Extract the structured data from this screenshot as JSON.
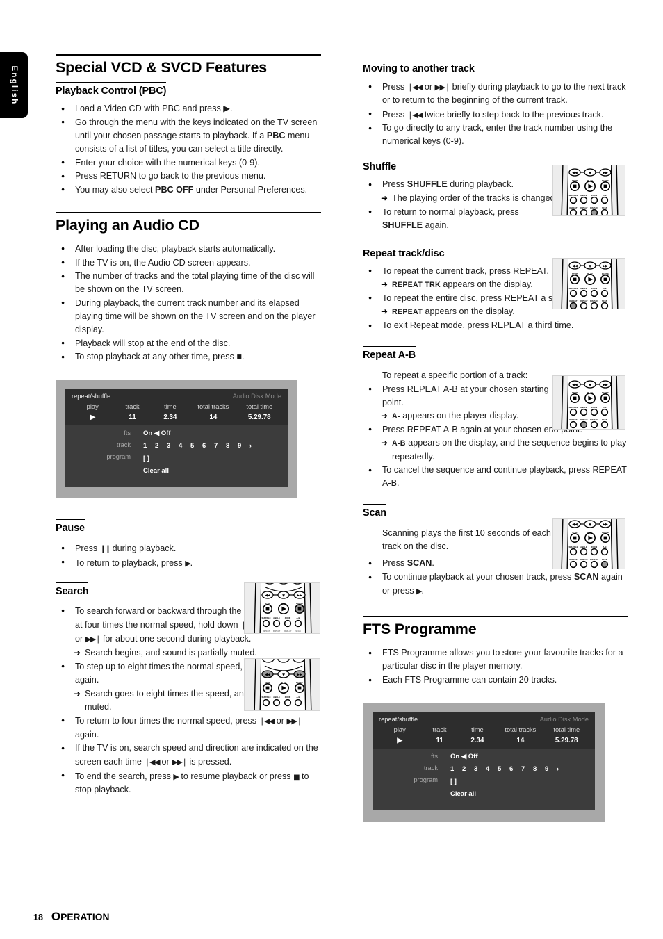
{
  "language_tab": "English",
  "footer": {
    "page_number": "18",
    "section_initial": "O",
    "section_rest": "PERATION"
  },
  "left_column": {
    "heading_main_1": "Special VCD & SVCD Features",
    "pbc": {
      "heading": "Playback Control (PBC)",
      "items": [
        "Load a Video CD with PBC and press ▶.",
        "Go through the menu with the keys indicated on the TV screen until your chosen passage starts to playback. If a PBC menu consists of a list of titles, you can select a title directly.",
        "Enter your choice with the numerical keys (0-9).",
        "Press RETURN to go back to the previous menu.",
        "You may also select PBC OFF under Personal Preferences."
      ]
    },
    "heading_main_2": "Playing an Audio CD",
    "audio_cd_items": [
      "After loading the disc, playback starts automatically.",
      "If the TV is on, the Audio CD screen appears.",
      "The number of tracks and the total playing time of the disc will be shown on the TV screen.",
      "During playback, the current track number and its elapsed playing time will be shown on the TV screen and on the player display.",
      "Playback will stop at the end of the disc.",
      "To stop playback at any other time, press ■."
    ],
    "pause": {
      "heading": "Pause",
      "items": [
        "Press ❙❙ during playback.",
        "To return to playback, press ▶."
      ]
    },
    "search": {
      "heading": "Search",
      "items": [
        "To search forward or backward through the disc at four times the normal speed, hold down ❘◀◀ or ▶▶❘ for about one second during playback.",
        "Search begins, and sound is partially muted.",
        "To step up to eight times the normal speed, press ❘◀◀ or ▶▶❘ again.",
        "Search goes to eight times the speed, and the sound is muted.",
        "To return to four times the normal speed, press ❘◀◀ or ▶▶❘ again.",
        "If the TV is on, search speed and direction are indicated on the screen each time ❘◀◀ or ▶▶❘ is pressed.",
        "To end the search, press ▶ to resume playback or press ■ to stop playback."
      ]
    }
  },
  "right_column": {
    "moving": {
      "heading": "Moving to another track",
      "items": [
        "Press ❘◀◀ or ▶▶❘ briefly during playback to go to the next track or to return to the beginning of the current track.",
        "Press ❘◀◀ twice briefly to step back to the previous track.",
        "To go directly to any track, enter the track number using the numerical keys (0-9)."
      ]
    },
    "shuffle": {
      "heading": "Shuffle",
      "items": [
        "Press SHUFFLE during playback.",
        "The playing order of the tracks is changed.",
        "To return to normal playback, press SHUFFLE again."
      ]
    },
    "repeat_track_disc": {
      "heading": "Repeat track/disc",
      "items": [
        "To repeat the current track, press REPEAT.",
        "REPEAT TRK appears on the display.",
        "To repeat the entire disc, press REPEAT a second time.",
        "REPEAT appears on the display.",
        "To exit Repeat mode, press REPEAT a third time."
      ]
    },
    "repeat_ab": {
      "heading": "Repeat A-B",
      "intro": "To repeat a specific portion of a track:",
      "items": [
        "Press REPEAT A-B at your chosen starting point.",
        "A- appears on the player display.",
        "Press REPEAT A-B again at your chosen end point.",
        "A-B appears on the display, and the sequence begins to play repeatedly.",
        "To cancel the sequence and continue playback, press REPEAT A-B."
      ]
    },
    "scan": {
      "heading": "Scan",
      "intro": "Scanning plays the first 10 seconds of each track on the disc.",
      "items": [
        "Press SCAN.",
        "To continue playback at your chosen track, press SCAN again or press ▶."
      ]
    },
    "heading_main_3": "FTS Programme",
    "fts_items": [
      "FTS Programme allows you to store your favourite tracks for a particular disc in the player memory.",
      "Each FTS Programme can contain 20 tracks."
    ]
  },
  "tv_screen": {
    "title": "repeat/shuffle",
    "mode": "Audio Disk Mode",
    "columns": [
      "play",
      "track",
      "time",
      "total tracks",
      "total time"
    ],
    "values": [
      "▶",
      "11",
      "2.34",
      "14",
      "5.29.78"
    ],
    "labels": [
      "fts",
      "track",
      "program"
    ],
    "fts_value": "On ◀ Off",
    "fts_arrows": "▼▶",
    "track_numbers": [
      "1",
      "2",
      "3",
      "4",
      "5",
      "6",
      "7",
      "8",
      "9",
      "›"
    ],
    "program_value": "[ ]",
    "clear_all": "Clear all"
  },
  "remote_labels": {
    "top_row": [
      "◀◀",
      "▼",
      "▶▶"
    ],
    "mid_row": [
      "STOP",
      "PLAY",
      "PAUSE"
    ],
    "row3": [
      "SHUFFLE",
      "ANGLE",
      "ZOOM",
      "A-B"
    ],
    "row4": [
      "REPEAT",
      "REPEAT",
      "DISPLAY",
      "SCAN"
    ]
  },
  "colors": {
    "tv_bezel": "#a8a8a8",
    "tv_panel_top": "#2d2d2d",
    "tv_panel_bottom": "#3c3c3c",
    "highlight": "#9a9a9a"
  }
}
